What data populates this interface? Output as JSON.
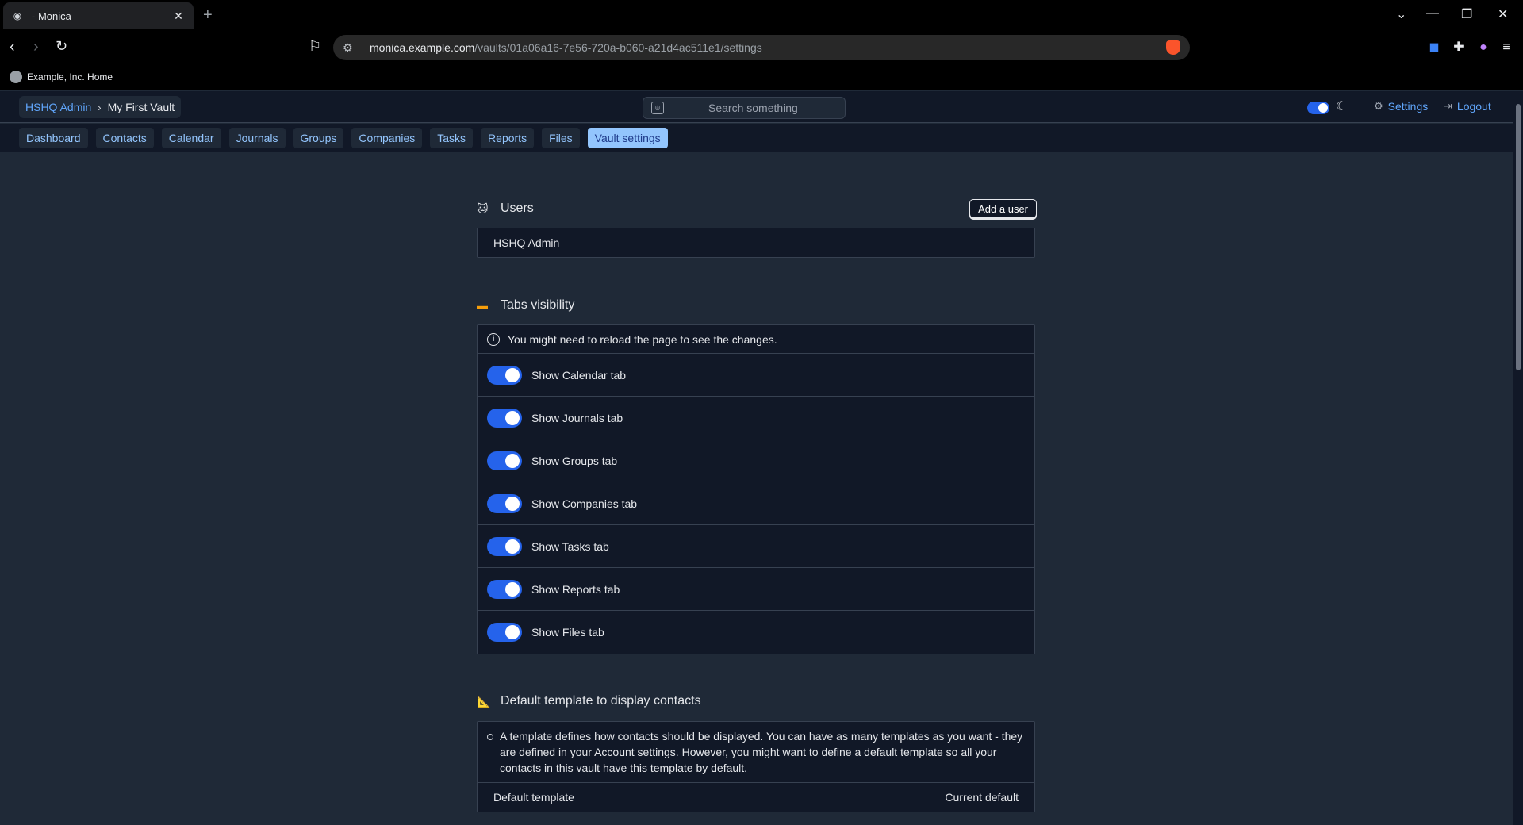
{
  "browser": {
    "tab_title": "- Monica",
    "url_host": "monica.example.com",
    "url_path": "/vaults/01a06a16-7e56-720a-b060-a21d4ac511e1/settings",
    "bookmark_label": "Example, Inc. Home"
  },
  "header": {
    "breadcrumb_user": "HSHQ Admin",
    "breadcrumb_vault": "My First Vault",
    "search_placeholder": "Search something",
    "settings_label": "Settings",
    "logout_label": "Logout"
  },
  "nav": {
    "tabs": [
      "Dashboard",
      "Contacts",
      "Calendar",
      "Journals",
      "Groups",
      "Companies",
      "Tasks",
      "Reports",
      "Files",
      "Vault settings"
    ],
    "active": "Vault settings"
  },
  "users": {
    "title": "Users",
    "add_label": "Add a user",
    "list": [
      "HSHQ Admin"
    ]
  },
  "tabs_visibility": {
    "title": "Tabs visibility",
    "notice": "You might need to reload the page to see the changes.",
    "toggles": [
      {
        "label": "Show Calendar tab",
        "on": true
      },
      {
        "label": "Show Journals tab",
        "on": true
      },
      {
        "label": "Show Groups tab",
        "on": true
      },
      {
        "label": "Show Companies tab",
        "on": true
      },
      {
        "label": "Show Tasks tab",
        "on": true
      },
      {
        "label": "Show Reports tab",
        "on": true
      },
      {
        "label": "Show Files tab",
        "on": true
      }
    ]
  },
  "default_template": {
    "title": "Default template to display contacts",
    "info": "A template defines how contacts should be displayed. You can have as many templates as you want - they are defined in your Account settings. However, you might want to define a default template so all your contacts in this vault have this template by default.",
    "row_label": "Default template",
    "row_value": "Current default"
  },
  "colors": {
    "accent": "#2563eb",
    "link": "#60a5fa",
    "active_tab": "#93c5fd",
    "background": "#1f2937",
    "card": "#111827"
  }
}
